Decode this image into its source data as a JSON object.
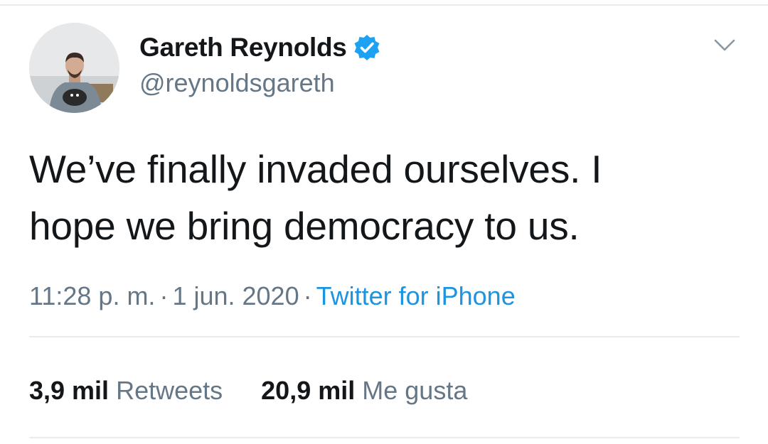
{
  "tweet": {
    "author": {
      "display_name": "Gareth Reynolds",
      "handle": "@reynoldsgareth",
      "verified": true,
      "avatar_icon": "user-avatar-photo"
    },
    "text_line1": "We’ve finally invaded ourselves. I",
    "text_line2": "hope we bring democracy to us.",
    "time": "11:28 p. m.",
    "separator": "·",
    "date": "1 jun. 2020",
    "source": "Twitter for iPhone",
    "retweets_count": "3,9 mil",
    "retweets_label": "Retweets",
    "likes_count": "20,9 mil",
    "likes_label": "Me gusta"
  },
  "icons": {
    "verified": "verified-badge-icon",
    "more": "chevron-down-icon"
  },
  "colors": {
    "text": "#14171a",
    "muted": "#657786",
    "link": "#1b95e0",
    "verified": "#1da1f2",
    "divider": "#e6ecf0"
  }
}
